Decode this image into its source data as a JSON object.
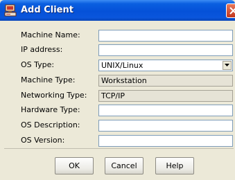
{
  "window": {
    "title": "Add Client"
  },
  "form": {
    "machine_name": {
      "label": "Machine Name:",
      "value": ""
    },
    "ip_address": {
      "label": "IP address:",
      "value": ""
    },
    "os_type": {
      "label": "OS Type:",
      "value": "UNIX/Linux"
    },
    "machine_type": {
      "label": "Machine Type:",
      "value": "Workstation"
    },
    "networking_type": {
      "label": "Networking Type:",
      "value": "TCP/IP"
    },
    "hardware_type": {
      "label": "Hardware Type:",
      "value": ""
    },
    "os_description": {
      "label": "OS Description:",
      "value": ""
    },
    "os_version": {
      "label": "OS Version:",
      "value": ""
    }
  },
  "buttons": {
    "ok": "OK",
    "cancel": "Cancel",
    "help": "Help"
  },
  "icons": {
    "app": "add-client-icon",
    "close": "close-icon",
    "dropdown": "chevron-down-icon"
  },
  "colors": {
    "title_bar": "#0551d8",
    "window_bg": "#ece9d8",
    "close_button": "#c2351c"
  }
}
